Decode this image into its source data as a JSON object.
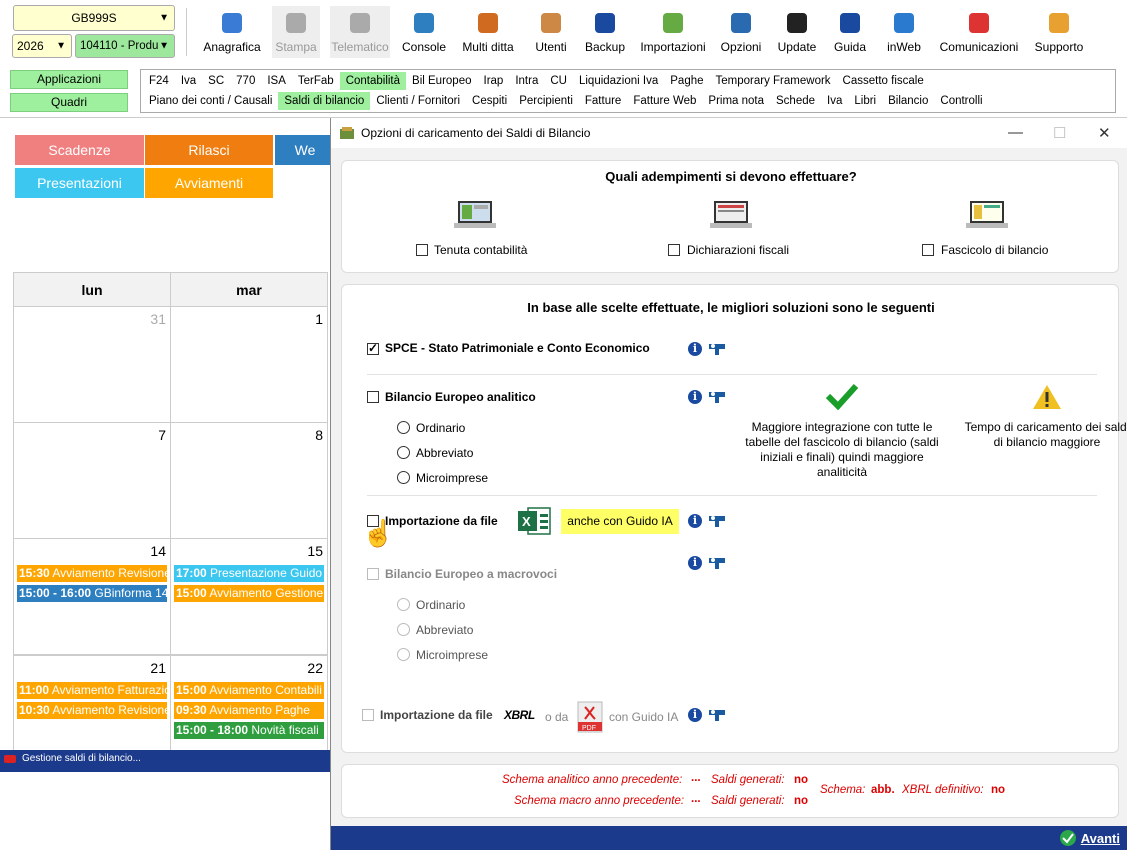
{
  "toolbar": {
    "company_select": "GB999S",
    "year_select": "2026",
    "ditta_select": "104110 - Produ",
    "buttons": [
      {
        "label": "Anagrafica",
        "icon": "id-card-icon"
      },
      {
        "label": "Stampa",
        "icon": "printer-icon",
        "disabled": true
      },
      {
        "label": "Telematico",
        "icon": "document-icon",
        "disabled": true
      },
      {
        "label": "Console",
        "icon": "console-icon"
      },
      {
        "label": "Multi ditta",
        "icon": "org-chart-icon"
      },
      {
        "label": "Utenti",
        "icon": "users-icon"
      },
      {
        "label": "Backup",
        "icon": "backup-icon"
      },
      {
        "label": "Importazioni",
        "icon": "import-icon"
      },
      {
        "label": "Opzioni",
        "icon": "gear-icon"
      },
      {
        "label": "Update",
        "icon": "update-monitor-icon"
      },
      {
        "label": "Guida",
        "icon": "help-icon"
      },
      {
        "label": "inWeb",
        "icon": "cloud-icon"
      },
      {
        "label": "Comunicazioni",
        "icon": "megaphone-icon"
      },
      {
        "label": "Supporto",
        "icon": "support-icon"
      }
    ]
  },
  "nav": {
    "applicazioni": "Applicazioni",
    "quadri": "Quadri"
  },
  "menu": {
    "row1": [
      "F24",
      "Iva",
      "SC",
      "770",
      "ISA",
      "TerFab",
      "Contabilità",
      "Bil Europeo",
      "Irap",
      "Intra",
      "CU",
      "Liquidazioni Iva",
      "Paghe",
      "Temporary Framework",
      "Cassetto fiscale"
    ],
    "row1_active": "Contabilità",
    "row2": [
      "Piano dei conti / Causali",
      "Saldi di bilancio",
      "Clienti / Fornitori",
      "Cespiti",
      "Percipienti",
      "Fatture",
      "Fatture Web",
      "Prima nota",
      "Schede",
      "Iva",
      "Libri",
      "Bilancio",
      "Controlli"
    ],
    "row2_active": "Saldi di bilancio"
  },
  "calendar": {
    "buttons": [
      {
        "label": "Scadenze",
        "color": "#f08080"
      },
      {
        "label": "Rilasci",
        "color": "#f07d10"
      },
      {
        "label": "We",
        "color": "#2e7fc0"
      },
      {
        "label": "Presentazioni",
        "color": "#3cc7f0"
      },
      {
        "label": "Avviamenti",
        "color": "#ffa500"
      }
    ],
    "days": [
      "lun",
      "mar"
    ],
    "weeks": [
      {
        "d1": "31",
        "d2": "1",
        "ev1": [],
        "ev2": []
      },
      {
        "d1": "7",
        "d2": "8",
        "ev1": [],
        "ev2": []
      },
      {
        "d1": "14",
        "d2": "15",
        "ev1": [
          {
            "time": "15:30",
            "text": "Avviamento Revisione",
            "color": "#ffa500"
          },
          {
            "time": "15:00 - 16:00",
            "text": "GBinforma 14",
            "color": "#2e7fc0"
          }
        ],
        "ev2": [
          {
            "time": "17:00",
            "text": "Presentazione Guido",
            "color": "#3cc7f0"
          },
          {
            "time": "15:00",
            "text": "Avviamento Gestione",
            "color": "#ffa500"
          }
        ]
      },
      {
        "d1": "21",
        "d2": "22",
        "ev1": [
          {
            "time": "11:00",
            "text": "Avviamento Fatturazio",
            "color": "#ffa500"
          },
          {
            "time": "10:30",
            "text": "Avviamento Revisione",
            "color": "#ffa500"
          }
        ],
        "ev2": [
          {
            "time": "15:00",
            "text": "Avviamento Contabili",
            "color": "#ffa500"
          },
          {
            "time": "09:30",
            "text": "Avviamento Paghe",
            "color": "#ffa500"
          },
          {
            "time": "15:00 - 18:00",
            "text": "Novità fiscali",
            "color": "#2e9e3e"
          }
        ]
      }
    ],
    "status": "Gestione saldi di bilancio..."
  },
  "dialog": {
    "title": "Opzioni di caricamento dei Saldi di Bilancio",
    "q_title": "Quali adempimenti si devono effettuare?",
    "q_options": [
      "Tenuta contabilità",
      "Dichiarazioni fiscali",
      "Fascicolo di bilancio"
    ],
    "sol_title": "In base alle scelte effettuate, le migliori soluzioni sono le seguenti",
    "spce": "SPCE  -  Stato Patrimoniale e Conto Economico",
    "bil_analitico": "Bilancio Europeo analitico",
    "radios": [
      "Ordinario",
      "Abbreviato",
      "Microimprese"
    ],
    "pro_text": "Maggiore integrazione con tutte le tabelle del fascicolo di bilancio (saldi iniziali e finali) quindi maggiore analiticità",
    "con_text": "Tempo di caricamento dei saldi di bilancio maggiore",
    "import_file": "Importazione da file",
    "guido_badge": "anche con Guido IA",
    "bil_macro": "Bilancio Europeo a macrovoci",
    "import_file2": "Importazione da file",
    "xbrl": "XBRL",
    "o_da": "o da",
    "pdf": "PDF",
    "con_guido": "con Guido IA",
    "status": {
      "schema_analitico": "Schema analitico anno precedente:",
      "dots": "...",
      "saldi_generati": "Saldi generati:",
      "no": "no",
      "schema_macro": "Schema macro anno precedente:",
      "schema": "Schema:",
      "abb": "abb.",
      "xbrl_def": "XBRL definitivo:"
    },
    "avanti": "Avanti"
  }
}
